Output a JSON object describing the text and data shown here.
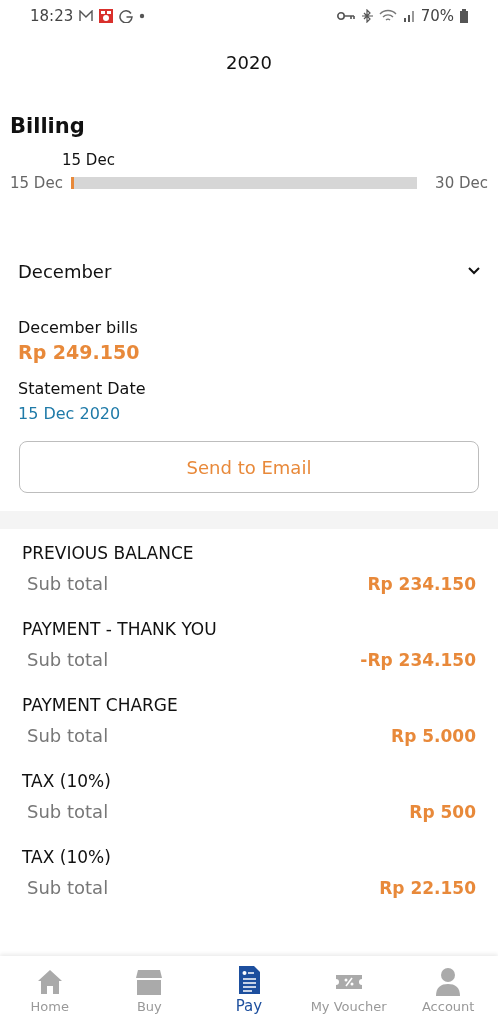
{
  "status_bar": {
    "time": "18:23",
    "battery": "70%"
  },
  "header": {
    "title": "2020"
  },
  "billing": {
    "title": "Billing",
    "current_label": "15 Dec",
    "start": "15 Dec",
    "end": "30 Dec",
    "level": 0.01
  },
  "month_select": {
    "value": "December",
    "expanded": false
  },
  "summary": {
    "bills_label": "December bills",
    "bills_amount": "Rp 249.150",
    "date_label": "Statement Date",
    "date_value": "15 Dec 2020"
  },
  "send_button": "Send to Email",
  "items": [
    {
      "title": "PREVIOUS BALANCE",
      "sub_label": "Sub total",
      "amount": "Rp 234.150"
    },
    {
      "title": "PAYMENT - THANK YOU",
      "sub_label": "Sub total",
      "amount": "-Rp 234.150"
    },
    {
      "title": "PAYMENT CHARGE",
      "sub_label": "Sub total",
      "amount": "Rp 5.000"
    },
    {
      "title": "TAX (10%)",
      "sub_label": "Sub total",
      "amount": "Rp 500"
    },
    {
      "title": "TAX (10%)",
      "sub_label": "Sub total",
      "amount": "Rp 22.150"
    }
  ],
  "nav": [
    {
      "kind": "home",
      "label": "Home",
      "selected": false
    },
    {
      "kind": "buy",
      "label": "Buy",
      "selected": false
    },
    {
      "kind": "pay",
      "label": "Pay",
      "selected": true
    },
    {
      "kind": "voucher",
      "label": "My Voucher",
      "selected": false
    },
    {
      "kind": "account",
      "label": "Account",
      "selected": false
    }
  ]
}
